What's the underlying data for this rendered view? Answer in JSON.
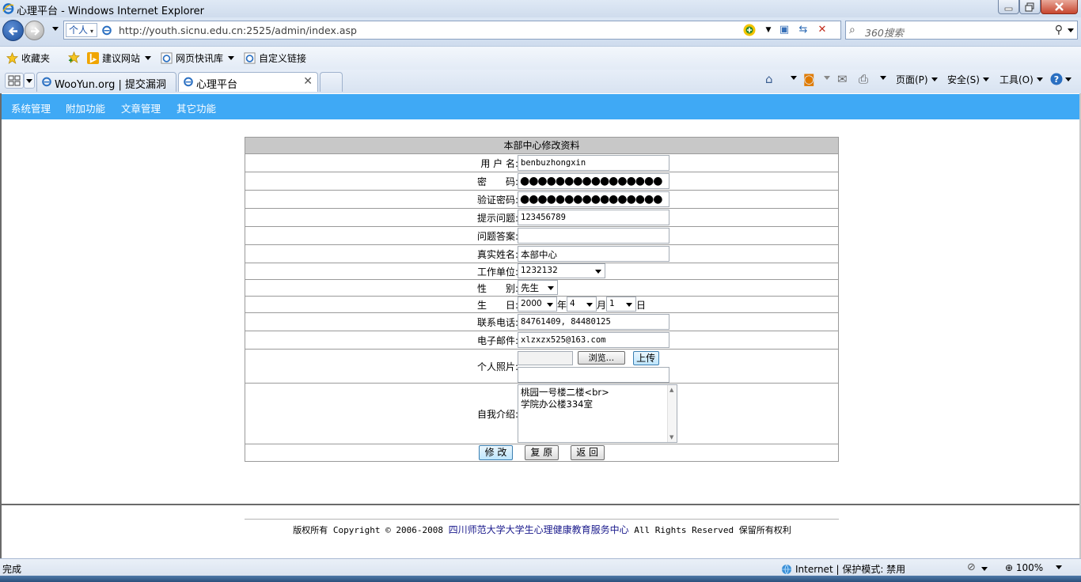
{
  "window": {
    "title": "心理平台 - Windows Internet Explorer"
  },
  "address_bar": {
    "profile_label": "个人",
    "url": "http://youth.sicnu.edu.cn:2525/admin/index.asp",
    "search_placeholder": "360搜索"
  },
  "favorites_bar": {
    "favorites_label": "收藏夹",
    "items": [
      "建议网站",
      "网页快讯库",
      "自定义链接"
    ]
  },
  "tabs": [
    {
      "label": "WooYun.org | 提交漏洞",
      "active": false
    },
    {
      "label": "心理平台",
      "active": true
    }
  ],
  "command_bar": {
    "page_label": "页面(P)",
    "safety_label": "安全(S)",
    "tools_label": "工具(O)"
  },
  "site_nav": [
    "系统管理",
    "附加功能",
    "文章管理",
    "其它功能"
  ],
  "form": {
    "title": "本部中心修改资料",
    "fields": {
      "username": {
        "label": "用 户 名:",
        "value": "benbuzhongxin"
      },
      "password": {
        "label": "密　　码:",
        "value": "●●●●●●●●●●●●●●●●"
      },
      "confirm_password": {
        "label": "验证密码:",
        "value": "●●●●●●●●●●●●●●●●"
      },
      "hint_question": {
        "label": "提示问题:",
        "value": "123456789"
      },
      "hint_answer": {
        "label": "问题答案:",
        "value": ""
      },
      "real_name": {
        "label": "真实姓名:",
        "value": "本部中心"
      },
      "work_unit": {
        "label": "工作单位:",
        "value": "1232132"
      },
      "gender": {
        "label": "性　　别:",
        "value": "先生"
      },
      "birthday": {
        "label": "生　　日:",
        "year": "2000",
        "year_unit": "年",
        "month": "4",
        "month_unit": "月",
        "day": "1",
        "day_unit": "日"
      },
      "phone": {
        "label": "联系电话:",
        "value": "84761409, 84480125"
      },
      "email": {
        "label": "电子邮件:",
        "value": "xlzxzx525@163.com"
      },
      "photo": {
        "label": "个人照片:",
        "browse_label": "浏览...",
        "upload_label": "上传"
      },
      "intro": {
        "label": "自我介绍:",
        "line1": "桃园一号楼二楼<br>",
        "line2": "学院办公楼334室"
      }
    },
    "buttons": {
      "submit": "修 改",
      "reset": "复 原",
      "back": "返 回"
    }
  },
  "footer": {
    "prefix": "版权所有 Copyright © 2006-2008 ",
    "org": "四川师范大学大学生心理健康教育服务中心",
    "suffix": " All Rights Reserved 保留所有权利"
  },
  "status_bar": {
    "left_text": "完成",
    "zone_text": "Internet | 保护模式: 禁用",
    "zoom": "100%"
  }
}
